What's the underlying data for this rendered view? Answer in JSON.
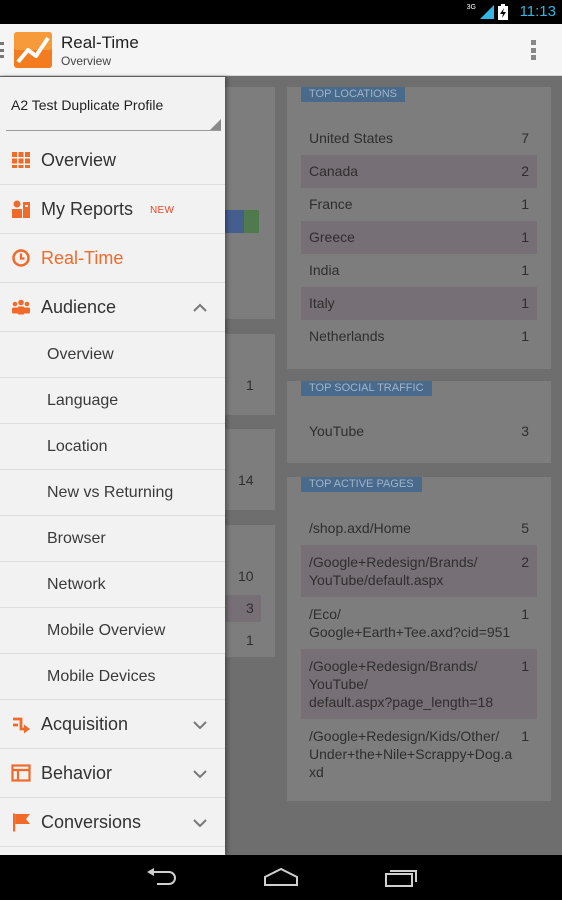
{
  "status_bar": {
    "network": "3G",
    "time": "11:13"
  },
  "action_bar": {
    "title": "Real-Time",
    "subtitle": "Overview"
  },
  "drawer": {
    "profile": "A2 Test Duplicate Profile",
    "items": [
      {
        "label": "Overview",
        "icon": "grid-icon"
      },
      {
        "label": "My Reports",
        "icon": "reports-icon",
        "badge": "NEW"
      },
      {
        "label": "Real-Time",
        "icon": "clock-icon",
        "active": true
      },
      {
        "label": "Audience",
        "icon": "people-icon",
        "expanded": true
      },
      {
        "label": "Acquisition",
        "icon": "acquisition-icon"
      },
      {
        "label": "Behavior",
        "icon": "behavior-icon"
      },
      {
        "label": "Conversions",
        "icon": "flag-icon"
      }
    ],
    "audience_subitems": [
      "Overview",
      "Language",
      "Location",
      "New vs Returning",
      "Browser",
      "Network",
      "Mobile Overview",
      "Mobile Devices"
    ]
  },
  "background": {
    "left_values": [
      "1",
      "14",
      "10",
      "3",
      "1"
    ],
    "top_locations": {
      "header": "TOP LOCATIONS",
      "rows": [
        {
          "label": "United States",
          "value": "7"
        },
        {
          "label": "Canada",
          "value": "2"
        },
        {
          "label": "France",
          "value": "1"
        },
        {
          "label": "Greece",
          "value": "1"
        },
        {
          "label": "India",
          "value": "1"
        },
        {
          "label": "Italy",
          "value": "1"
        },
        {
          "label": "Netherlands",
          "value": "1"
        }
      ]
    },
    "top_social": {
      "header": "TOP SOCIAL TRAFFIC",
      "rows": [
        {
          "label": "YouTube",
          "value": "3"
        }
      ]
    },
    "top_pages": {
      "header": "TOP ACTIVE PAGES",
      "rows": [
        {
          "label": "/shop.axd/Home",
          "value": "5"
        },
        {
          "label": "/Google+Redesign/Brands/\nYouTube/default.aspx",
          "value": "2"
        },
        {
          "label": "/Eco/\nGoogle+Earth+Tee.axd?cid=951",
          "value": "1"
        },
        {
          "label": "/Google+Redesign/Brands/\nYouTube/\ndefault.aspx?page_length=18",
          "value": "1"
        },
        {
          "label": "/Google+Redesign/Kids/Other/\nUnder+the+Nile+Scrappy+Dog.a\nxd",
          "value": "1"
        }
      ]
    }
  },
  "colors": {
    "accent": "#f06a2a",
    "drawer_bg": "#f2f2f2",
    "status_clock": "#33b5e5"
  }
}
